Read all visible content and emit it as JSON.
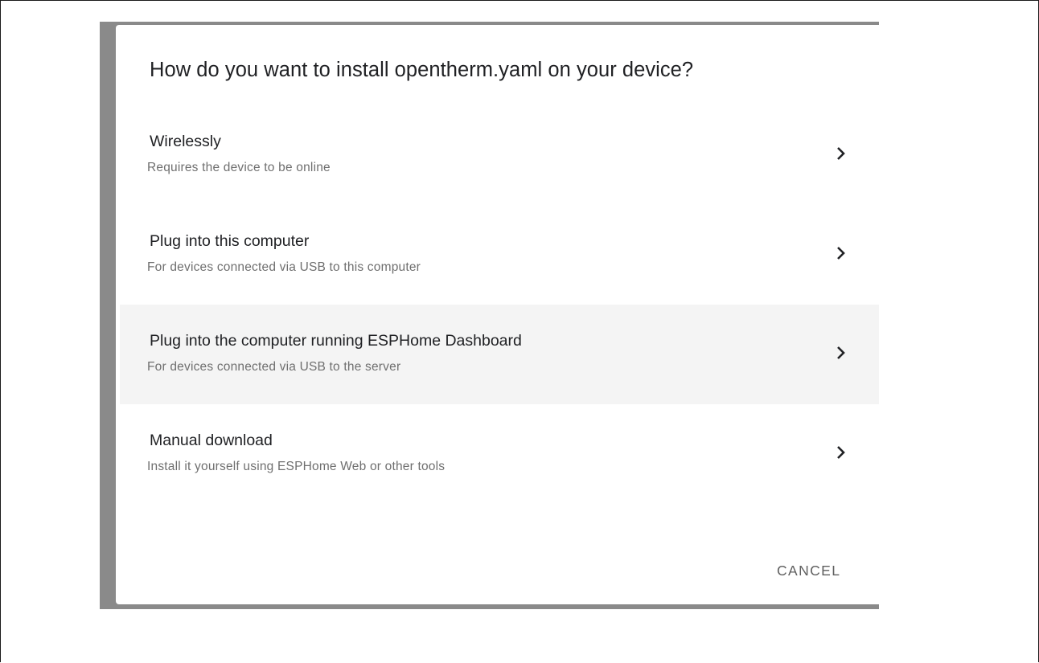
{
  "dialog": {
    "title": "How do you want to install opentherm.yaml on your device?",
    "options": [
      {
        "label": "Wirelessly",
        "description": "Requires the device to be online",
        "icon": "chevron-right-icon"
      },
      {
        "label": "Plug into this computer",
        "description": "For devices connected via USB to this computer",
        "icon": "chevron-right-icon"
      },
      {
        "label": "Plug into the computer running ESPHome Dashboard",
        "description": "For devices connected via USB to the server",
        "icon": "chevron-right-icon"
      },
      {
        "label": "Manual download",
        "description": "Install it yourself using ESPHome Web or other tools",
        "icon": "chevron-right-icon"
      }
    ],
    "cancel_label": "CANCEL"
  },
  "colors": {
    "backdrop": "#8a8a8a",
    "hover_row": "#f4f4f4",
    "primary_text": "#202124",
    "secondary_text": "#6f6f6f"
  }
}
